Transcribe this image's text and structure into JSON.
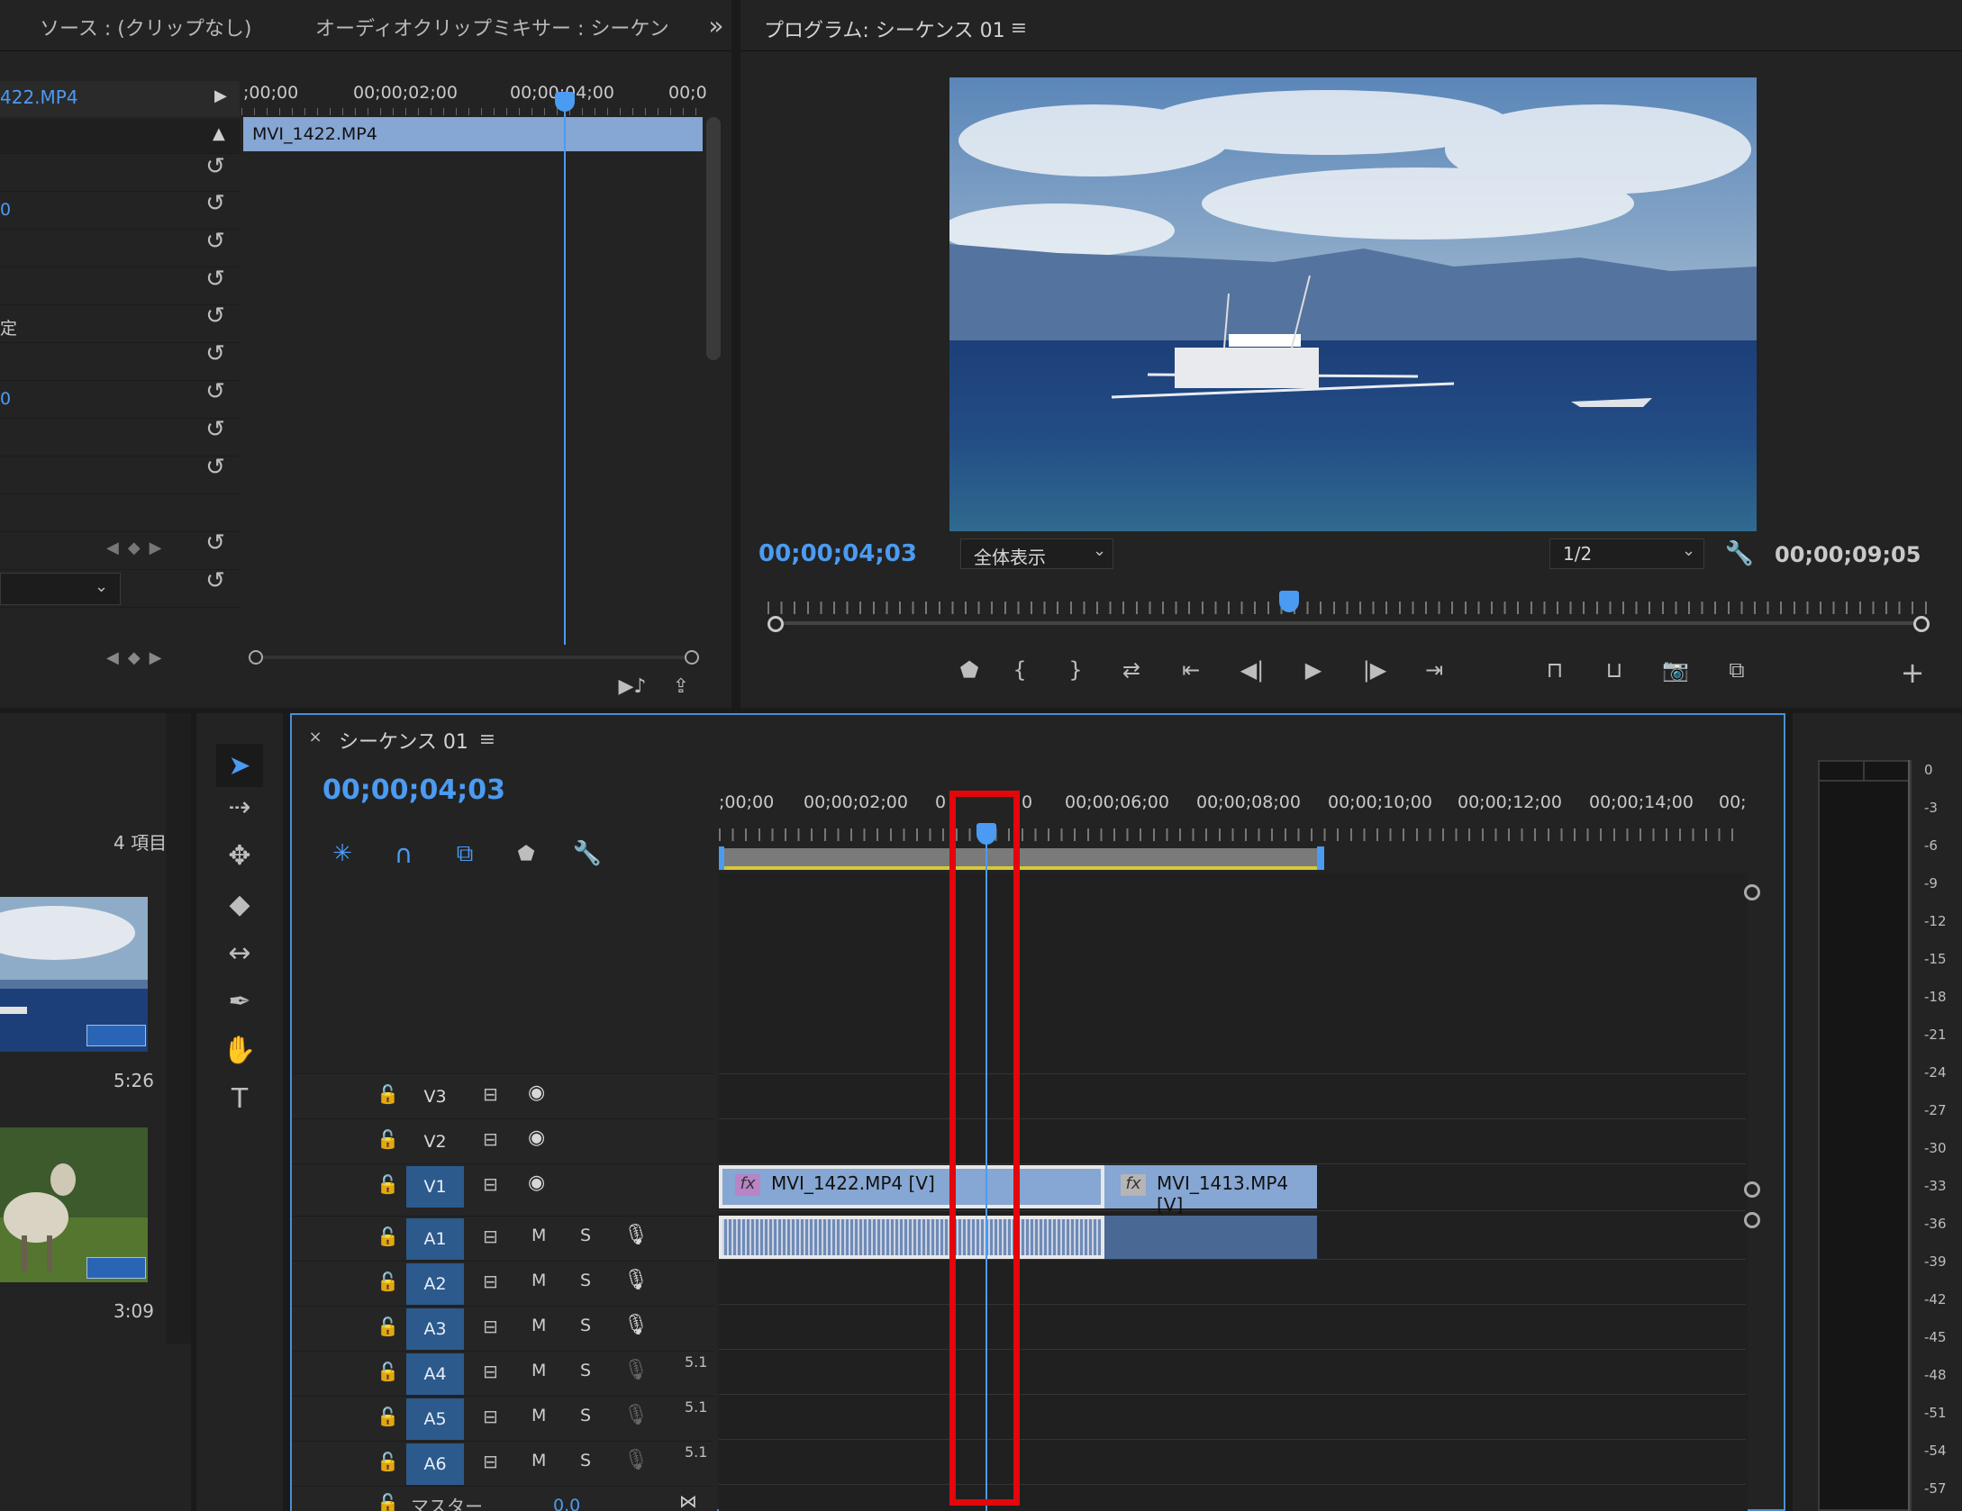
{
  "source_panel": {
    "tabs": [
      "ソース : (クリップなし)",
      "オーディオクリップミキサー : シーケン"
    ],
    "clip_name_partial": "422.MP4",
    "ruler": [
      ";00;00",
      "00;00;02;00",
      "00;00;04;00",
      "00;0"
    ],
    "clip_bar_label": "MVI_1422.MP4",
    "row_partials": [
      "0",
      "定",
      "0"
    ]
  },
  "program": {
    "title": "プログラム: シーケンス 01",
    "timecode": "00;00;04;03",
    "fit_option": "全体表示",
    "resolution": "1/2",
    "duration": "00;00;09;05"
  },
  "project": {
    "item_count": "4 項目",
    "clips": [
      {
        "duration": "5:26"
      },
      {
        "duration": "3:09"
      }
    ]
  },
  "timeline": {
    "title": "シーケンス 01",
    "timecode": "00;00;04;03",
    "ruler": [
      ";00;00",
      "00;00;02;00",
      "0",
      "0",
      "00;00;06;00",
      "00;00;08;00",
      "00;00;10;00",
      "00;00;12;00",
      "00;00;14;00",
      "00;"
    ],
    "ruler_cut": "00;00;04;",
    "video_tracks": [
      "V3",
      "V2",
      "V1"
    ],
    "audio_tracks": [
      "A1",
      "A2",
      "A3",
      "A4",
      "A5",
      "A6"
    ],
    "mute": "M",
    "solo": "S",
    "surround": "5.1",
    "master_label": "マスター",
    "master_value": "0.0",
    "clip_v1_a": "MVI_1422.MP4 [V]",
    "clip_v1_b": "MVI_1413.MP4 [V]",
    "fx": "fx"
  },
  "meter": {
    "db_labels": [
      "0",
      "-3",
      "-6",
      "-9",
      "-12",
      "-15",
      "-18",
      "-21",
      "-24",
      "-27",
      "-30",
      "-33",
      "-36",
      "-39",
      "-42",
      "-45",
      "-48",
      "-51",
      "-54",
      "-57"
    ]
  },
  "colors": {
    "accent_blue": "#4b9bf2",
    "clip_blue": "#86a6d3",
    "highlight_red": "#e3060b",
    "work_area_yellow": "#d6c93a"
  }
}
